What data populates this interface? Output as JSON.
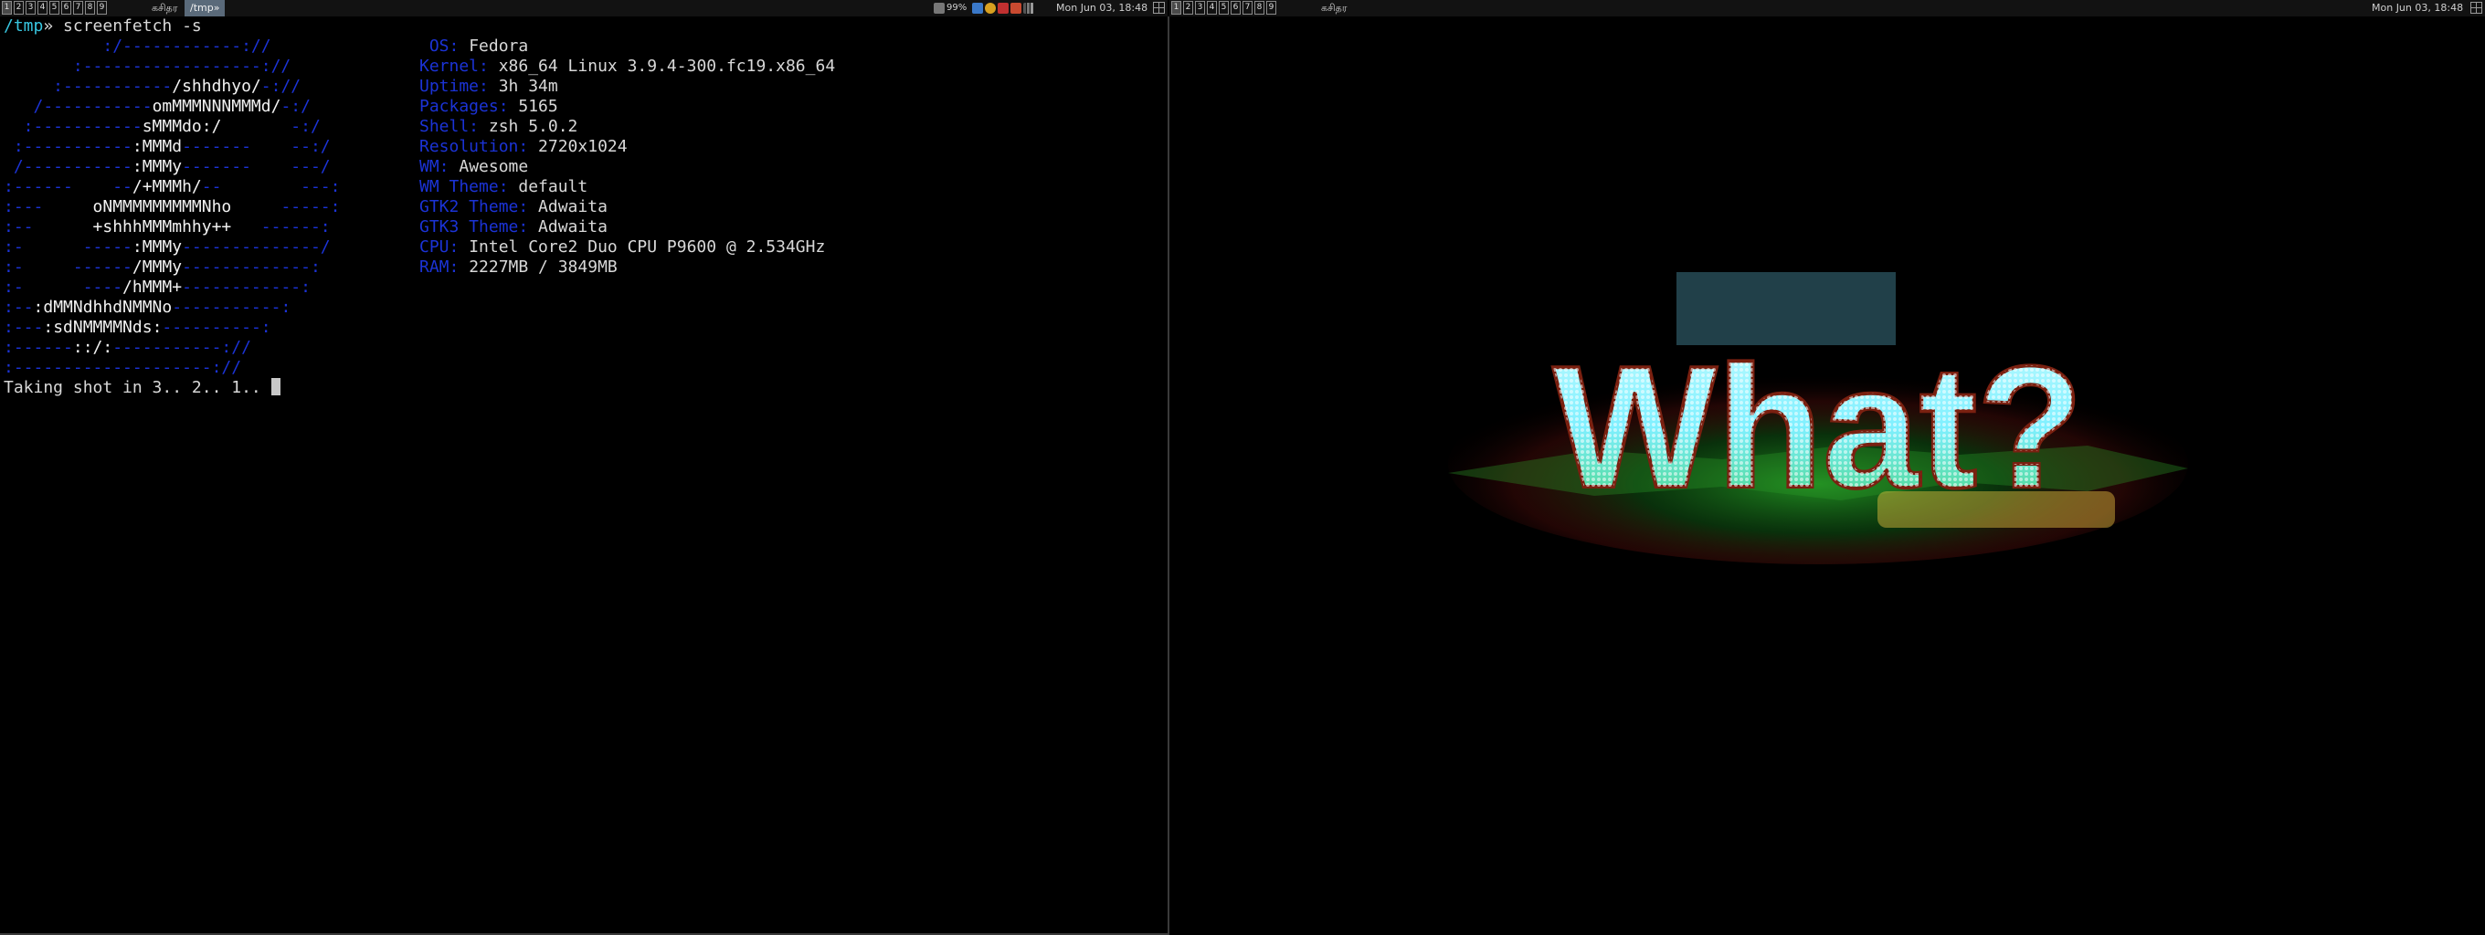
{
  "left_bar": {
    "tags": [
      "1",
      "2",
      "3",
      "4",
      "5",
      "6",
      "7",
      "8",
      "9"
    ],
    "layout_label": "≡",
    "lang": "கசிதர",
    "active_task": "/tmp»",
    "battery": "99%",
    "clock": "Mon Jun 03, 18:48"
  },
  "right_bar": {
    "tags": [
      "1",
      "2",
      "3",
      "4",
      "5",
      "6",
      "7",
      "8",
      "9"
    ],
    "lang": "கசிதர",
    "clock": "Mon Jun 03, 18:48"
  },
  "terminal": {
    "prompt_path": "/tmp",
    "prompt_arrow": "»",
    "command": " screenfetch -s",
    "art_lines": [
      [
        [
          "b",
          "          :/------------://"
        ]
      ],
      [
        [
          "b",
          "       :------------------://"
        ]
      ],
      [
        [
          "b",
          "     :-----------"
        ],
        [
          "w",
          "/shhdhyo/"
        ],
        [
          "b",
          "-://"
        ]
      ],
      [
        [
          "b",
          "   /-----------"
        ],
        [
          "w",
          "omMMMNNNMMMd/"
        ],
        [
          "b",
          "-:/"
        ]
      ],
      [
        [
          "b",
          "  :-----------"
        ],
        [
          "w",
          "sMMMdo:/"
        ],
        [
          "b",
          "       -:/"
        ]
      ],
      [
        [
          "b",
          " :-----------"
        ],
        [
          "w",
          ":MMMd"
        ],
        [
          "b",
          "-------    --:/"
        ]
      ],
      [
        [
          "b",
          " /-----------"
        ],
        [
          "w",
          ":MMMy"
        ],
        [
          "b",
          "-------    ---/"
        ]
      ],
      [
        [
          "b",
          ":------    --"
        ],
        [
          "w",
          "/+MMMh/"
        ],
        [
          "b",
          "--        ---:"
        ]
      ],
      [
        [
          "b",
          ":---     "
        ],
        [
          "w",
          "oNMMMMMMMMMNho"
        ],
        [
          "b",
          "     -----:"
        ]
      ],
      [
        [
          "b",
          ":--      "
        ],
        [
          "w",
          "+shhhMMMmhhy++"
        ],
        [
          "b",
          "   ------:"
        ]
      ],
      [
        [
          "b",
          ":-      -----"
        ],
        [
          "w",
          ":MMMy"
        ],
        [
          "b",
          "--------------/"
        ]
      ],
      [
        [
          "b",
          ":-     ------"
        ],
        [
          "w",
          "/MMMy"
        ],
        [
          "b",
          "-------------:"
        ]
      ],
      [
        [
          "b",
          ":-      ----"
        ],
        [
          "w",
          "/hMMM+"
        ],
        [
          "b",
          "------------:"
        ]
      ],
      [
        [
          "b",
          ":--"
        ],
        [
          "w",
          ":dMMNdhhdNMMNo"
        ],
        [
          "b",
          "-----------:"
        ]
      ],
      [
        [
          "b",
          ":---"
        ],
        [
          "w",
          ":sdNMMMMNds:"
        ],
        [
          "b",
          "----------:"
        ]
      ],
      [
        [
          "b",
          ":------"
        ],
        [
          "w",
          "::/:"
        ],
        [
          "b",
          "-----------://"
        ]
      ],
      [
        [
          "b",
          ":--------------------://"
        ]
      ]
    ],
    "info": [
      {
        "key": " OS: ",
        "value": "Fedora"
      },
      {
        "key": "Kernel: ",
        "value": "x86_64 Linux 3.9.4-300.fc19.x86_64"
      },
      {
        "key": "Uptime: ",
        "value": "3h 34m"
      },
      {
        "key": "Packages: ",
        "value": "5165"
      },
      {
        "key": "Shell: ",
        "value": "zsh 5.0.2"
      },
      {
        "key": "Resolution: ",
        "value": "2720x1024"
      },
      {
        "key": "WM: ",
        "value": "Awesome"
      },
      {
        "key": "WM Theme: ",
        "value": "default"
      },
      {
        "key": "GTK2 Theme: ",
        "value": "Adwaita"
      },
      {
        "key": "GTK3 Theme: ",
        "value": "Adwaita"
      },
      {
        "key": "CPU: ",
        "value": "Intel Core2 Duo CPU P9600 @ 2.534GHz"
      },
      {
        "key": "RAM: ",
        "value": "2227MB / 3849MB"
      }
    ],
    "status_line": "Taking shot in 3.. 2.. 1.. "
  },
  "wallpaper": {
    "logo_text": "What?",
    "colors": {
      "glow_green": "#3cff3c",
      "glow_red": "#c0201a",
      "cyan": "#7ff0ff",
      "gold": "#e8c040"
    }
  }
}
